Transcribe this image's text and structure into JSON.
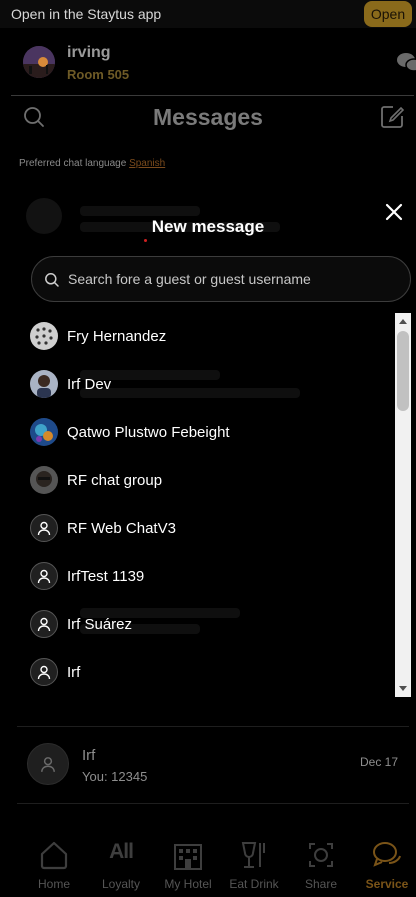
{
  "banner": {
    "text": "Open in the Staytus app",
    "open_label": "Open"
  },
  "user": {
    "name": "irving",
    "room": "Room 505"
  },
  "header": {
    "title": "Messages"
  },
  "preferences": {
    "label": "Preferred chat language",
    "language": "Spanish"
  },
  "modal": {
    "title": "New message",
    "search_placeholder": "Search fore a guest or guest username",
    "guests": [
      {
        "name": "Fry Hernandez",
        "avatar": "photo-dots"
      },
      {
        "name": "Irf Dev",
        "avatar": "photo-person"
      },
      {
        "name": "Qatwo Plustwo Febeight",
        "avatar": "photo-globe"
      },
      {
        "name": "RF chat group",
        "avatar": "photo-face"
      },
      {
        "name": "RF Web ChatV3",
        "avatar": "person-icon"
      },
      {
        "name": "IrfTest 1139",
        "avatar": "person-icon"
      },
      {
        "name": "Irf Suárez",
        "avatar": "person-icon"
      },
      {
        "name": "Irf",
        "avatar": "person-icon"
      }
    ]
  },
  "conversation": {
    "name": "Irf",
    "preview": "You: 12345",
    "date": "Dec 17"
  },
  "nav": {
    "items": [
      {
        "label": "Home",
        "icon": "home-icon"
      },
      {
        "label": "Loyalty",
        "icon": "loyalty-icon",
        "glyph": "All"
      },
      {
        "label": "My Hotel",
        "icon": "hotel-icon"
      },
      {
        "label": "Eat Drink",
        "icon": "dining-icon"
      },
      {
        "label": "Share",
        "icon": "share-icon"
      },
      {
        "label": "Service",
        "icon": "chat-icon"
      }
    ],
    "active": "Service"
  },
  "colors": {
    "accent": "#8a6a1b",
    "active_nav": "#7a5418",
    "background": "#000000"
  }
}
